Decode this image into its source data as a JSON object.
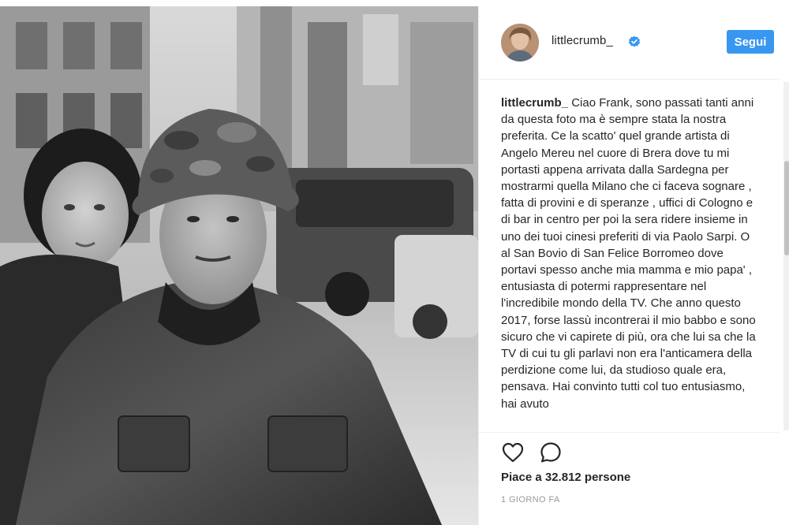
{
  "post": {
    "username": "littlecrumb_",
    "verified": true,
    "follow_label": "Segui",
    "caption_username": "littlecrumb_",
    "caption_text": "Ciao Frank, sono passati tanti anni da questa foto ma è sempre stata la nostra preferita. Ce la scatto' quel grande artista di Angelo Mereu nel cuore di Brera dove tu mi portasti appena arrivata dalla Sardegna per mostrarmi quella Milano che ci faceva sognare , fatta di provini e di speranze , uffici di Cologno e di bar in centro per poi la sera ridere insieme in uno dei tuoi cinesi preferiti di via Paolo Sarpi. O al San Bovio di San Felice Borromeo dove portavi spesso anche mia mamma e mio papa' , entusiasta di potermi rappresentare nel l'incredibile mondo della TV. Che anno questo 2017, forse lassù incontrerai il mio babbo e sono sicuro che vi capirete di più, ora che lui sa che la TV di cui tu gli parlavi non era l'anticamera della perdizione come lui, da studioso quale era, pensava. Hai convinto tutti col tuo entusiasmo, hai avuto",
    "likes_text": "Piace a 32.812 persone",
    "timestamp": "1 GIORNO FA"
  },
  "icons": {
    "like": "heart-outline-icon",
    "comment": "speech-bubble-icon",
    "verified": "verified-badge-icon"
  },
  "colors": {
    "accent": "#3897f0",
    "text": "#262626",
    "muted": "#999999",
    "border": "#efefef"
  }
}
